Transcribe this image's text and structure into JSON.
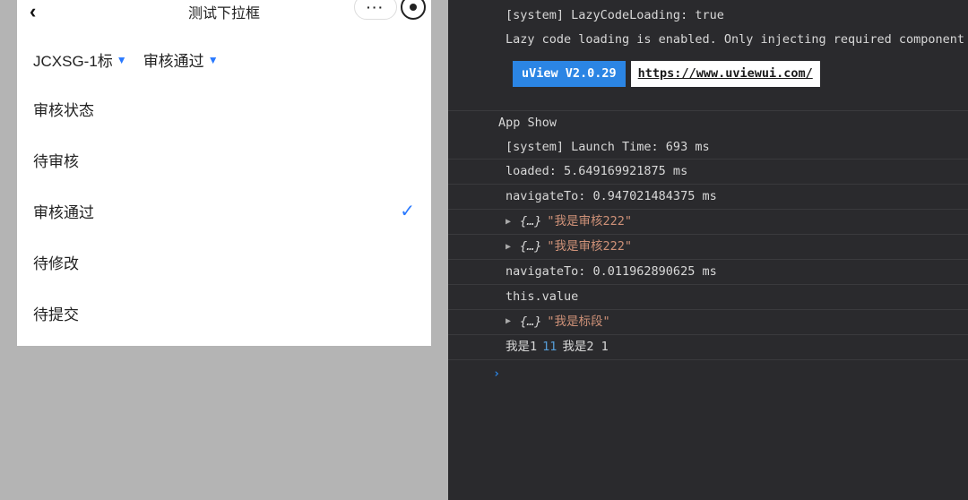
{
  "app": {
    "title": "测试下拉框",
    "filters": {
      "primary_label": "JCXSG-1标",
      "secondary_label": "审核通过"
    },
    "dropdown": {
      "group_label": "审核状态",
      "items": [
        {
          "label": "待审核",
          "selected": false
        },
        {
          "label": "审核通过",
          "selected": true
        },
        {
          "label": "待修改",
          "selected": false
        },
        {
          "label": "待提交",
          "selected": false
        }
      ]
    }
  },
  "console": {
    "lines": {
      "l0": "[system] LazyCodeLoading: true",
      "l1": "Lazy code loading is enabled. Only injecting required component",
      "uview_version": "uView V2.0.29",
      "uview_url": "https://www.uviewui.com/",
      "l2": "App Show",
      "l3": "[system] Launch Time: 693 ms",
      "l4": "loaded: 5.649169921875 ms",
      "l5": "navigateTo: 0.947021484375 ms",
      "obj_placeholder": "{…}",
      "obj1_str": "\"我是审核222\"",
      "obj2_str": "\"我是审核222\"",
      "l6": "navigateTo: 0.011962890625 ms",
      "l7": "this.value",
      "obj3_str": "\"我是标段\"",
      "final_a": "我是1",
      "final_b": "11",
      "final_c": "我是2 1"
    }
  }
}
